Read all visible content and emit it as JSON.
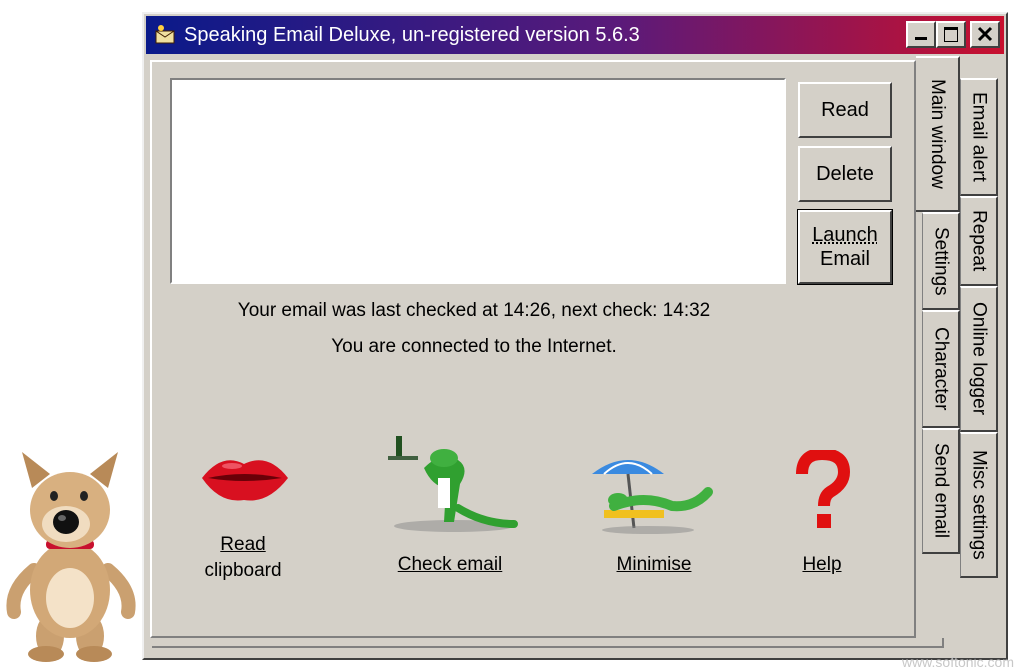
{
  "window": {
    "title": "Speaking Email Deluxe, un-registered version 5.6.3"
  },
  "buttons": {
    "read": "Read",
    "delete": "Delete",
    "launch_line1": "Launch",
    "launch_line2": "Email"
  },
  "status": {
    "last_checked": "Your email was last checked at 14:26, next check: 14:32",
    "connection": "You are connected to the Internet."
  },
  "actions": {
    "read_clipboard_line1": "Read",
    "read_clipboard_line2": "clipboard",
    "check_email": "Check email",
    "minimise": "Minimise",
    "help": "Help"
  },
  "tabs": {
    "main_window": "Main window",
    "settings": "Settings",
    "character": "Character",
    "send_email": "Send email",
    "email_alert": "Email alert",
    "repeat": "Repeat",
    "online_logger": "Online logger",
    "misc_settings": "Misc settings"
  },
  "watermark": "www.softonic.com",
  "colors": {
    "titlebar_start": "#0a1a8a",
    "titlebar_end": "#c8102e",
    "face": "#d4d0c8"
  }
}
